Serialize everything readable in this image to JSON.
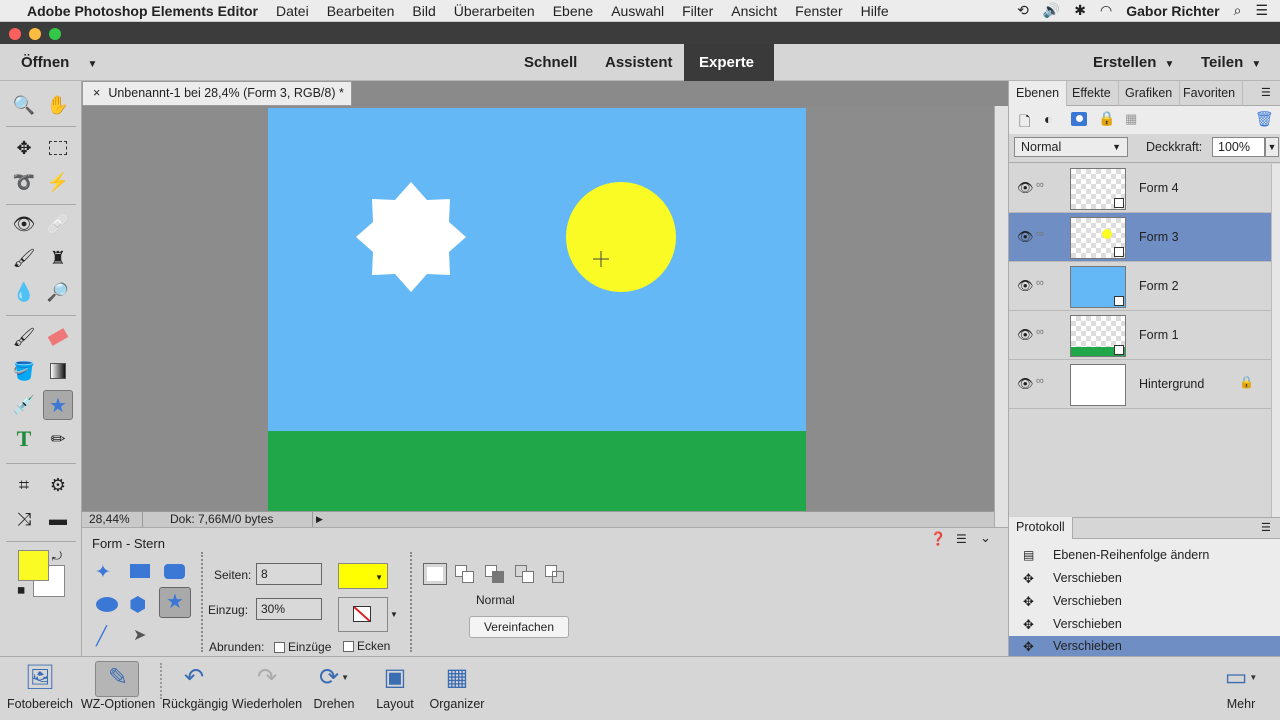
{
  "menubar": {
    "app": "Adobe Photoshop Elements Editor",
    "items": [
      "Datei",
      "Bearbeiten",
      "Bild",
      "Überarbeiten",
      "Ebene",
      "Auswahl",
      "Filter",
      "Ansicht",
      "Fenster",
      "Hilfe"
    ],
    "user": "Gabor Richter"
  },
  "modebar": {
    "open": "Öffnen",
    "modes": [
      "Schnell",
      "Assistent",
      "Experte"
    ],
    "create": "Erstellen",
    "share": "Teilen"
  },
  "document": {
    "tab_title": "Unbenannt-1 bei 28,4% (Form 3, RGB/8) *",
    "zoom": "28,44%",
    "doc_info": "Dok: 7,66M/0 bytes"
  },
  "canvas_colors": {
    "sky": "#64b8f6",
    "grass": "#20a74a",
    "sun": "#fafb24",
    "star": "#ffffff"
  },
  "options": {
    "title": "Form - Stern",
    "sides_label": "Seiten:",
    "sides_value": "8",
    "indent_label": "Einzug:",
    "indent_value": "30%",
    "fill_color": "#ffff00",
    "round_label": "Abrunden:",
    "indents_check": "Einzüge",
    "corners_check": "Ecken",
    "mode": "Normal",
    "simplify_button": "Vereinfachen"
  },
  "layers_panel": {
    "tabs": [
      "Ebenen",
      "Effekte",
      "Grafiken",
      "Favoriten"
    ],
    "blend_mode": "Normal",
    "opacity_label": "Deckkraft:",
    "opacity_value": "100%",
    "layers": [
      {
        "name": "Form 4"
      },
      {
        "name": "Form 3"
      },
      {
        "name": "Form 2"
      },
      {
        "name": "Form 1"
      },
      {
        "name": "Hintergrund"
      }
    ]
  },
  "history_panel": {
    "title": "Protokoll",
    "items": [
      "Ebenen-Reihenfolge ändern",
      "Verschieben",
      "Verschieben",
      "Verschieben",
      "Verschieben"
    ]
  },
  "taskbar": {
    "items": [
      "Fotobereich",
      "WZ-Optionen",
      "Rückgängig",
      "Wiederholen",
      "Drehen",
      "Layout",
      "Organizer"
    ],
    "more": "Mehr"
  }
}
